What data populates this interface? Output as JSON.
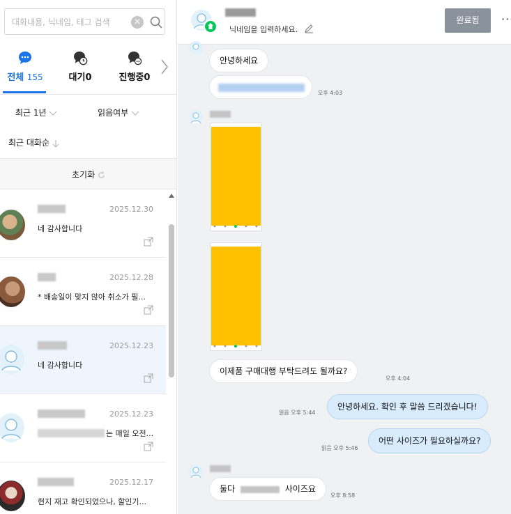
{
  "search": {
    "placeholder": "대화내용, 닉네임, 태그 검색"
  },
  "tabs": [
    {
      "label": "전체",
      "count": "155"
    },
    {
      "label": "대기",
      "count": "0"
    },
    {
      "label": "진행중",
      "count": "0"
    }
  ],
  "filters": {
    "period": "최근 1년",
    "read": "읽음여부",
    "sort": "최근 대화순",
    "reset": "초기화"
  },
  "conversations": [
    {
      "date": "2025.12.30",
      "message": "네 감사합니다"
    },
    {
      "date": "2025.12.28",
      "message": "* 배송일이 맞지 않아 취소가 필..."
    },
    {
      "date": "2025.12.23",
      "message": "네 감사합니다"
    },
    {
      "date": "2025.12.23",
      "message": "는 매일 오전..."
    },
    {
      "date": "2025.12.17",
      "message": "현지 재고 확인되었으나, 할인기..."
    }
  ],
  "header": {
    "nickname_placeholder": "닉네임을 입력하세요.",
    "done_button": "완료됨",
    "more": "···"
  },
  "messages": {
    "m1": {
      "text": "안녕하세요"
    },
    "m2": {
      "time": "오후 4:03"
    },
    "m3": {
      "text": "이제품 구매대행 부탁드려도 될까요?",
      "time": "오후 4:04"
    },
    "m4": {
      "text": "안녕하세요. 확인 후 말씀 드리겠습니다!",
      "read": "읽음",
      "time": "오후 5:44"
    },
    "m5": {
      "text": "어떤 사이즈가 필요하실까요?",
      "read": "읽음",
      "time": "오후 5:46"
    },
    "m6": {
      "text_before": "둘다",
      "text_after": "사이즈요",
      "time": "오후 8:58"
    }
  },
  "colors": {
    "accent": "#1a73e8",
    "outgoing_bubble": "#d9ecfe",
    "done_button": "#8a929b",
    "image_placeholder": "#ffc000",
    "online_badge": "#03c75a"
  }
}
